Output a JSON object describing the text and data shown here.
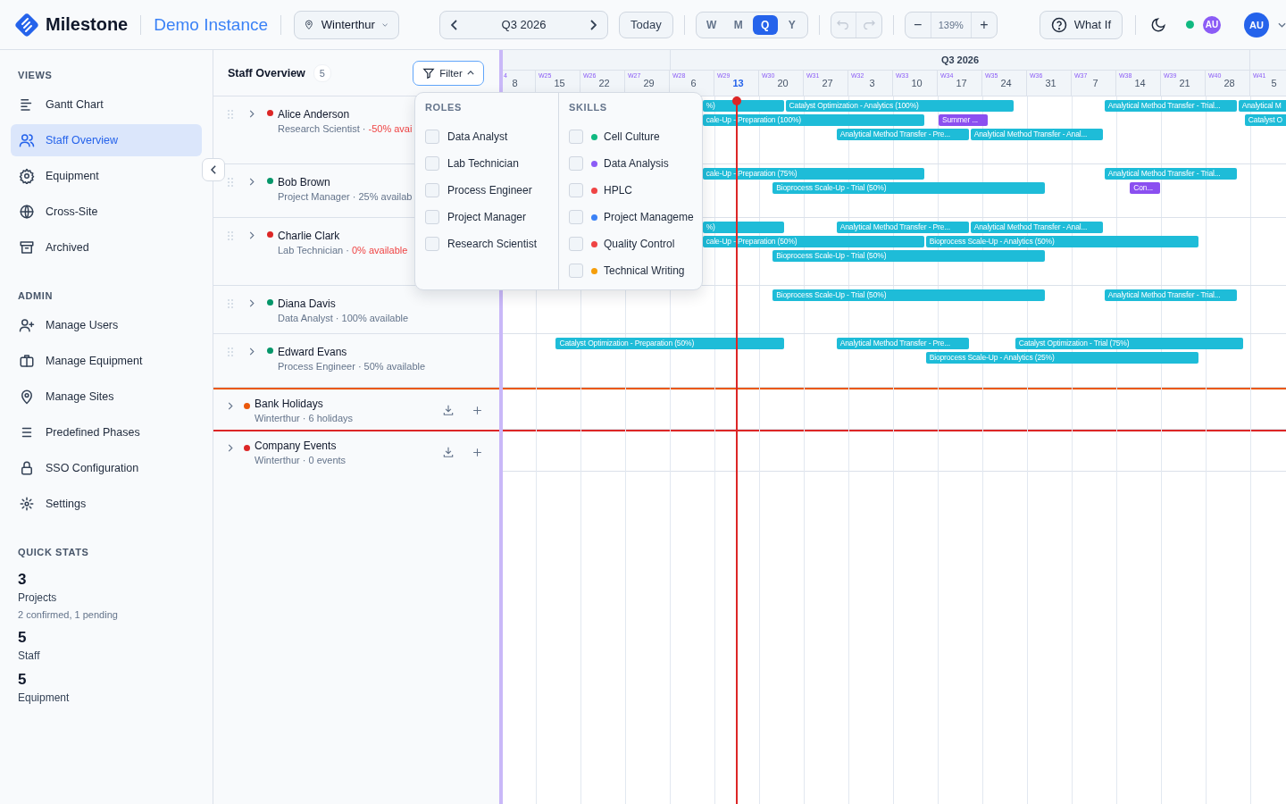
{
  "topbar": {
    "app_name": "Milestone",
    "instance": "Demo Instance",
    "location": "Winterthur",
    "period": "Q3 2026",
    "today_button": "Today",
    "scales": [
      {
        "label": "W",
        "selected": false
      },
      {
        "label": "M",
        "selected": false
      },
      {
        "label": "Q",
        "selected": true
      },
      {
        "label": "Y",
        "selected": false
      }
    ],
    "undo_disabled": true,
    "redo_disabled": true,
    "zoom_out": "−",
    "zoom": "139%",
    "zoom_in": "+",
    "what_if": "What If",
    "online": true,
    "presence_avatar": "AU",
    "user_avatar": "AU"
  },
  "sidebar": {
    "sections": [
      {
        "title": "VIEWS",
        "items": [
          {
            "label": "Gantt Chart",
            "selected": false
          },
          {
            "label": "Staff Overview",
            "selected": true
          },
          {
            "label": "Equipment",
            "selected": false
          },
          {
            "label": "Cross-Site",
            "selected": false
          },
          {
            "label": "Archived",
            "selected": false
          }
        ]
      },
      {
        "title": "ADMIN",
        "items": [
          {
            "label": "Manage Users",
            "selected": false
          },
          {
            "label": "Manage Equipment",
            "selected": false
          },
          {
            "label": "Manage Sites",
            "selected": false
          },
          {
            "label": "Predefined Phases",
            "selected": false
          },
          {
            "label": "SSO Configuration",
            "selected": false
          },
          {
            "label": "Settings",
            "selected": false
          }
        ]
      }
    ],
    "quick_stats": {
      "title": "QUICK STATS",
      "stats": [
        {
          "value": "3",
          "label": "Projects",
          "detail": "2 confirmed, 1 pending"
        },
        {
          "value": "5",
          "label": "Staff"
        },
        {
          "value": "5",
          "label": "Equipment"
        }
      ]
    }
  },
  "panel": {
    "title": "Staff Overview",
    "count": "5",
    "filter_button": "Filter",
    "filter_open": true
  },
  "filter": {
    "roles_title": "ROLES",
    "roles": [
      {
        "label": "Data Analyst",
        "checked": false
      },
      {
        "label": "Lab Technician",
        "checked": false
      },
      {
        "label": "Process Engineer",
        "checked": false
      },
      {
        "label": "Project Manager",
        "checked": false
      },
      {
        "label": "Research Scientist",
        "checked": false
      }
    ],
    "skills_title": "SKILLS",
    "skills": [
      {
        "label": "Cell Culture",
        "checked": false,
        "color": "#10b981"
      },
      {
        "label": "Data Analysis",
        "checked": false,
        "color": "#8b5cf6"
      },
      {
        "label": "HPLC",
        "checked": false,
        "color": "#ef4444"
      },
      {
        "label": "Project Manageme",
        "checked": false,
        "color": "#3b82f6"
      },
      {
        "label": "Quality Control",
        "checked": false,
        "color": "#ef4444"
      },
      {
        "label": "Technical Writing",
        "checked": false,
        "color": "#f59e0b"
      }
    ]
  },
  "timeline": {
    "quarter": "Q3 2026",
    "weeks": [
      {
        "week": "4",
        "day": "8",
        "current": false
      },
      {
        "week": "W25",
        "day": "15",
        "current": false
      },
      {
        "week": "W26",
        "day": "22",
        "current": false
      },
      {
        "week": "W27",
        "day": "29",
        "current": false
      },
      {
        "week": "W28",
        "day": "6",
        "current": false
      },
      {
        "week": "W29",
        "day": "13",
        "current": true
      },
      {
        "week": "W30",
        "day": "20",
        "current": false
      },
      {
        "week": "W31",
        "day": "27",
        "current": false
      },
      {
        "week": "W32",
        "day": "3",
        "current": false
      },
      {
        "week": "W33",
        "day": "10",
        "current": false
      },
      {
        "week": "W34",
        "day": "17",
        "current": false
      },
      {
        "week": "W35",
        "day": "24",
        "current": false
      },
      {
        "week": "W36",
        "day": "31",
        "current": false
      },
      {
        "week": "W37",
        "day": "7",
        "current": false
      },
      {
        "week": "W38",
        "day": "14",
        "current": false
      },
      {
        "week": "W39",
        "day": "21",
        "current": false
      },
      {
        "week": "W40",
        "day": "28",
        "current": false
      },
      {
        "week": "W41",
        "day": "5",
        "current": false
      }
    ]
  },
  "staff": [
    {
      "name": "Alice Anderson",
      "color": "#dc2626",
      "role": "Research Scientist ·",
      "availability": "-50% avai",
      "warning": true,
      "lanes": [
        {
          "bars": [
            {
              "label": "%)",
              "color": "#1ebcd8"
            },
            {
              "label": "Catalyst Optimization - Analytics (100%)",
              "color": "#1ebcd8"
            },
            {
              "label": "Analytical Method Transfer - Trial...",
              "color": "#1ebcd8"
            },
            {
              "label": "Analytical M",
              "color": "#1ebcd8"
            }
          ]
        },
        {
          "bars": [
            {
              "label": "cale-Up - Preparation (100%)",
              "color": "#1ebcd8"
            },
            {
              "label": "Summer ...",
              "color": "#8b4ff0"
            },
            {
              "label": "Catalyst O",
              "color": "#1ebcd8"
            }
          ]
        },
        {
          "bars": [
            {
              "label": "Analytical Method Transfer - Pre...",
              "color": "#1ebcd8"
            },
            {
              "label": "Analytical Method Transfer - Anal...",
              "color": "#1ebcd8"
            }
          ]
        }
      ]
    },
    {
      "name": "Bob Brown",
      "color": "#059669",
      "role": "Project Manager ·",
      "availability": "25% availab",
      "warning": false,
      "lanes": [
        {
          "bars": [
            {
              "label": "cale-Up - Preparation (75%)",
              "color": "#1ebcd8"
            },
            {
              "label": "Analytical Method Transfer - Trial...",
              "color": "#1ebcd8"
            }
          ]
        },
        {
          "bars": [
            {
              "label": "Bioprocess Scale-Up - Trial (50%)",
              "color": "#1ebcd8"
            },
            {
              "label": "Con...",
              "color": "#8b4ff0"
            }
          ]
        }
      ]
    },
    {
      "name": "Charlie Clark",
      "color": "#dc2626",
      "role": "Lab Technician ·",
      "availability": "0% available",
      "warning": true,
      "lanes": [
        {
          "bars": [
            {
              "label": "%)",
              "color": "#1ebcd8"
            },
            {
              "label": "Analytical Method Transfer - Pre...",
              "color": "#1ebcd8"
            },
            {
              "label": "Analytical Method Transfer - Anal...",
              "color": "#1ebcd8"
            }
          ]
        },
        {
          "bars": [
            {
              "label": "cale-Up - Preparation (50%)",
              "color": "#1ebcd8"
            },
            {
              "label": "Bioprocess Scale-Up - Analytics (50%)",
              "color": "#1ebcd8"
            }
          ]
        },
        {
          "bars": [
            {
              "label": "Bioprocess Scale-Up - Trial (50%)",
              "color": "#1ebcd8"
            }
          ]
        }
      ]
    },
    {
      "name": "Diana Davis",
      "color": "#059669",
      "role": "Data Analyst ·",
      "availability": "100% available",
      "warning": false,
      "lanes": [
        {
          "bars": [
            {
              "label": "Bioprocess Scale-Up - Trial (50%)",
              "color": "#1ebcd8"
            },
            {
              "label": "Analytical Method Transfer - Trial...",
              "color": "#1ebcd8"
            }
          ]
        }
      ]
    },
    {
      "name": "Edward Evans",
      "color": "#059669",
      "role": "Process Engineer ·",
      "availability": "50% available",
      "warning": false,
      "lanes": [
        {
          "bars": [
            {
              "label": "Catalyst Optimization - Preparation (50%)",
              "color": "#1ebcd8"
            },
            {
              "label": "Analytical Method Transfer - Pre...",
              "color": "#1ebcd8"
            },
            {
              "label": "Catalyst Optimization - Trial (75%)",
              "color": "#1ebcd8"
            }
          ]
        },
        {
          "bars": [
            {
              "label": "Bioprocess Scale-Up - Analytics (25%)",
              "color": "#1ebcd8"
            }
          ]
        }
      ]
    }
  ],
  "calendars": [
    {
      "name": "Bank Holidays",
      "color": "#ea580c",
      "details": "Winterthur · 6 holidays"
    },
    {
      "name": "Company Events",
      "color": "#dc2626",
      "details": "Winterthur · 0 events"
    }
  ]
}
